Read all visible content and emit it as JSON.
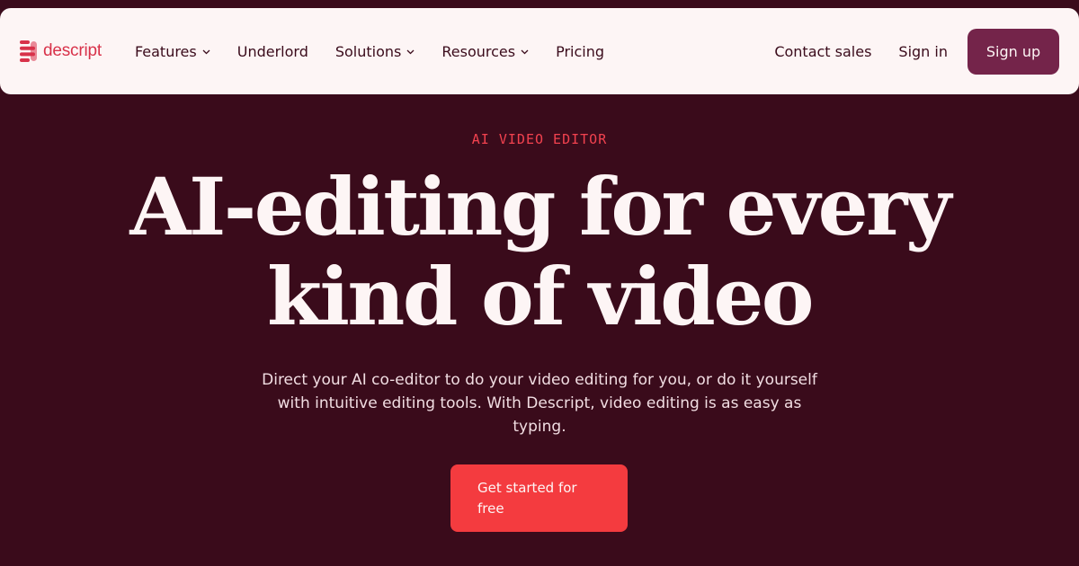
{
  "brand": {
    "name": "descript",
    "logo_color": "#d8324a"
  },
  "nav": {
    "items": [
      {
        "label": "Features",
        "has_dropdown": true
      },
      {
        "label": "Underlord",
        "has_dropdown": false
      },
      {
        "label": "Solutions",
        "has_dropdown": true
      },
      {
        "label": "Resources",
        "has_dropdown": true
      },
      {
        "label": "Pricing",
        "has_dropdown": false
      }
    ],
    "contact_sales": "Contact sales",
    "sign_in": "Sign in",
    "sign_up": "Sign up"
  },
  "hero": {
    "eyebrow": "AI VIDEO EDITOR",
    "headline": "AI-editing for every kind of video",
    "subtext": "Direct your AI co-editor to do your video editing for you, or do it yourself with intuitive editing tools. With Descript, video editing is as easy as typing.",
    "cta": "Get started for free"
  },
  "colors": {
    "background": "#3a0b1b",
    "navbar": "#fdf5f5",
    "accent": "#f43b3f",
    "signup_button": "#74244a",
    "eyebrow": "#f2424f"
  }
}
